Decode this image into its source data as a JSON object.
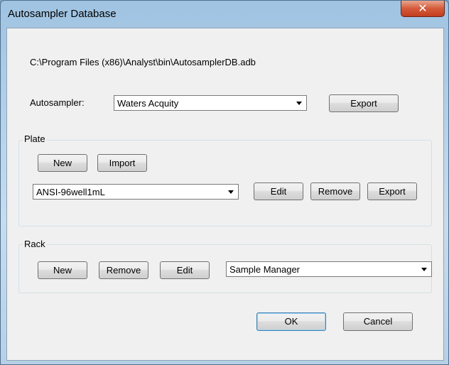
{
  "window": {
    "title": "Autosampler Database",
    "close_glyph": "✕"
  },
  "path": "C:\\Program Files (x86)\\Analyst\\bin\\AutosamplerDB.adb",
  "autosampler": {
    "label": "Autosampler:",
    "selected": "Waters Acquity",
    "export_label": "Export"
  },
  "plate": {
    "label": "Plate",
    "new_label": "New",
    "import_label": "Import",
    "selected": "ANSI-96well1mL",
    "edit_label": "Edit",
    "remove_label": "Remove",
    "export_label": "Export"
  },
  "rack": {
    "label": "Rack",
    "new_label": "New",
    "remove_label": "Remove",
    "edit_label": "Edit",
    "selected": "Sample Manager"
  },
  "footer": {
    "ok_label": "OK",
    "cancel_label": "Cancel"
  }
}
